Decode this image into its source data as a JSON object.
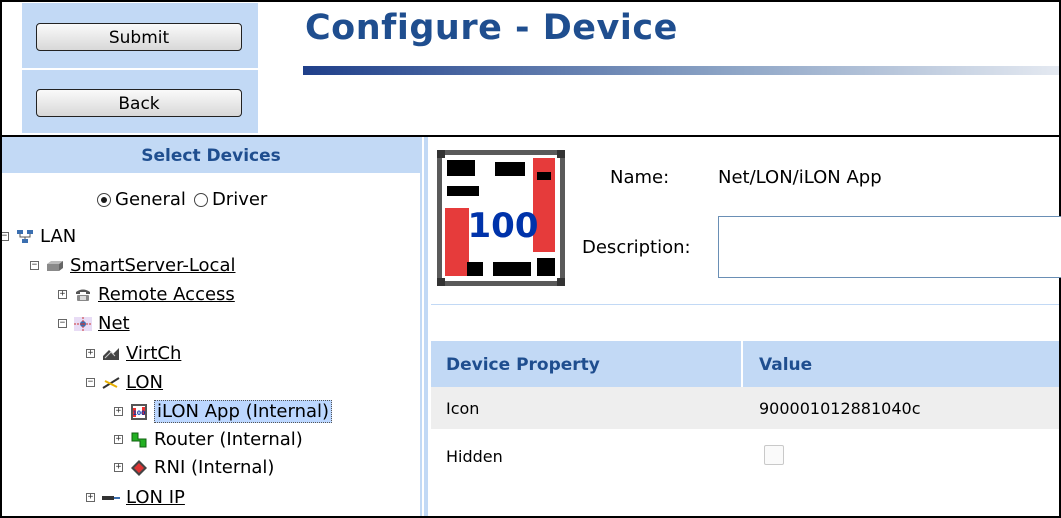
{
  "toolbar": {
    "submit_label": "Submit",
    "back_label": "Back"
  },
  "page": {
    "title": "Configure - Device"
  },
  "tree": {
    "header": "Select Devices",
    "view_options": [
      {
        "label": "General",
        "selected": true
      },
      {
        "label": "Driver",
        "selected": false
      }
    ],
    "nodes": [
      {
        "label": "LAN",
        "icon": "lan-icon",
        "expander": "minus",
        "underlined": false
      },
      {
        "label": "SmartServer-Local",
        "icon": "server-icon",
        "expander": "minus",
        "underlined": true
      },
      {
        "label": "Remote Access",
        "icon": "phone-icon",
        "expander": "plus",
        "underlined": true
      },
      {
        "label": "Net",
        "icon": "network-icon",
        "expander": "minus",
        "underlined": true
      },
      {
        "label": "VirtCh",
        "icon": "virtual-channel-icon",
        "expander": "plus",
        "underlined": true
      },
      {
        "label": "LON",
        "icon": "lon-channel-icon",
        "expander": "minus",
        "underlined": true
      },
      {
        "label": "iLON App (Internal)",
        "icon": "ilon-app-icon",
        "expander": "plus",
        "selected": true
      },
      {
        "label": "Router (Internal)",
        "icon": "router-icon",
        "expander": "plus",
        "underlined": false
      },
      {
        "label": "RNI (Internal)",
        "icon": "rni-icon",
        "expander": "plus",
        "underlined": false
      },
      {
        "label": "LON IP",
        "icon": "lon-ip-icon",
        "expander": "plus",
        "underlined": true
      }
    ]
  },
  "device": {
    "icon_text": "100",
    "name_label": "Name:",
    "name_value": "Net/LON/iLON App",
    "description_label": "Description:",
    "description_value": ""
  },
  "properties": {
    "columns": [
      "Device Property",
      "Value"
    ],
    "rows": [
      {
        "property": "Icon",
        "value": "900001012881040c"
      },
      {
        "property": "Hidden",
        "value_checked": false
      }
    ]
  },
  "colors": {
    "accent": "#1f4e8f",
    "panel": "#c2d9f5",
    "selection": "#bcd7ff"
  }
}
